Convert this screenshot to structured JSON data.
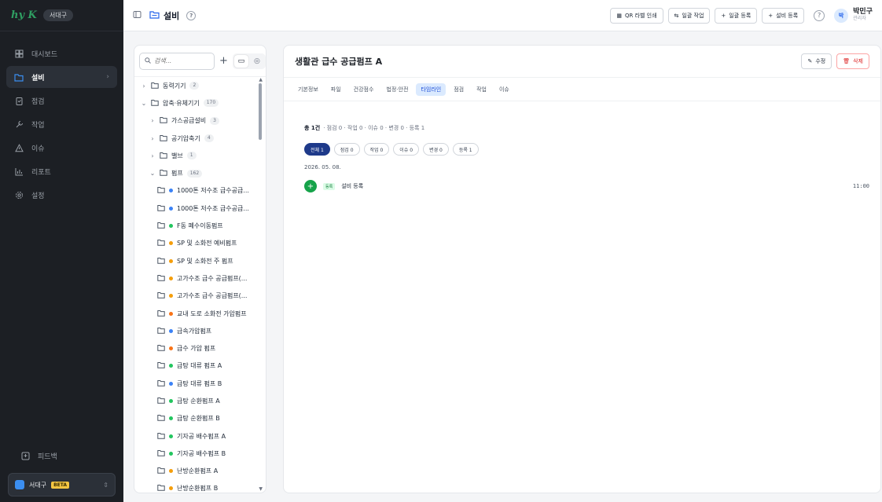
{
  "sidebar": {
    "logo": "hy K",
    "org_chip": "서대구",
    "nav": [
      {
        "label": "대시보드",
        "icon": "dashboard-icon"
      },
      {
        "label": "설비",
        "icon": "folder-icon",
        "active": true
      },
      {
        "label": "점검",
        "icon": "clipboard-icon"
      },
      {
        "label": "작업",
        "icon": "wrench-icon"
      },
      {
        "label": "이슈",
        "icon": "warning-icon"
      },
      {
        "label": "리포트",
        "icon": "chart-icon"
      },
      {
        "label": "설정",
        "icon": "gear-icon"
      }
    ],
    "feedback": "피드백",
    "org_switch": {
      "name": "서대구",
      "badge": "BETA"
    }
  },
  "topbar": {
    "title": "설비",
    "buttons": {
      "qr": "QR 라벨 인쇄",
      "bulk_work": "일괄 작업",
      "bulk_register": "일괄 등록",
      "equipment_register": "설비 등록"
    },
    "user": {
      "initial": "박",
      "name": "박민구",
      "role": "관리자"
    }
  },
  "tree": {
    "search_placeholder": "검색...",
    "items": [
      {
        "type": "group",
        "caret": "›",
        "label": "동력기기",
        "count": "2",
        "indent": 0
      },
      {
        "type": "group",
        "caret": "⌄",
        "label": "압축·유체기기",
        "count": "170",
        "indent": 0,
        "open": true
      },
      {
        "type": "group",
        "caret": "›",
        "label": "가스공급설비",
        "count": "3",
        "indent": 1
      },
      {
        "type": "group",
        "caret": "›",
        "label": "공기압축기",
        "count": "4",
        "indent": 1
      },
      {
        "type": "group",
        "caret": "›",
        "label": "밸브",
        "count": "1",
        "indent": 1
      },
      {
        "type": "group",
        "caret": "⌄",
        "label": "펌프",
        "count": "162",
        "indent": 1,
        "open": true
      },
      {
        "type": "leaf",
        "label": "1000톤 저수조 급수공급...",
        "color": "#3b82f6"
      },
      {
        "type": "leaf",
        "label": "1000톤 저수조 급수공급...",
        "color": "#3b82f6"
      },
      {
        "type": "leaf",
        "label": "F동 폐수이동펌프",
        "color": "#22c55e"
      },
      {
        "type": "leaf",
        "label": "SP 및 소화전 예비펌프",
        "color": "#f59e0b"
      },
      {
        "type": "leaf",
        "label": "SP 및 소화전 주 펌프",
        "color": "#f59e0b"
      },
      {
        "type": "leaf",
        "label": "고가수조 급수 공급펌프(...",
        "color": "#f59e0b"
      },
      {
        "type": "leaf",
        "label": "고가수조 급수 공급펌프(...",
        "color": "#f59e0b"
      },
      {
        "type": "leaf",
        "label": "교내 도로 소화전 가압펌프",
        "color": "#f97316"
      },
      {
        "type": "leaf",
        "label": "급속가압펌프",
        "color": "#3b82f6"
      },
      {
        "type": "leaf",
        "label": "급수 가압 펌프",
        "color": "#f97316"
      },
      {
        "type": "leaf",
        "label": "급탕 대류 펌프 A",
        "color": "#22c55e"
      },
      {
        "type": "leaf",
        "label": "급탕 대류 펌프 B",
        "color": "#3b82f6"
      },
      {
        "type": "leaf",
        "label": "급탕 순환펌프 A",
        "color": "#22c55e"
      },
      {
        "type": "leaf",
        "label": "급탕 순환펌프 B",
        "color": "#22c55e"
      },
      {
        "type": "leaf",
        "label": "기자공 배수펌프 A",
        "color": "#22c55e"
      },
      {
        "type": "leaf",
        "label": "기자공 배수펌프 B",
        "color": "#22c55e"
      },
      {
        "type": "leaf",
        "label": "난방순환펌프 A",
        "color": "#f59e0b"
      },
      {
        "type": "leaf",
        "label": "난방순환펌프 B",
        "color": "#f59e0b"
      }
    ]
  },
  "detail": {
    "title": "생활관 급수 공급펌프 A",
    "edit": "수정",
    "delete": "삭제",
    "tabs": [
      "기본정보",
      "파일",
      "건강점수",
      "법정·안전",
      "타임라인",
      "점검",
      "작업",
      "이슈"
    ],
    "active_tab": "타임라인",
    "summary": {
      "total": "총 1건",
      "rest": "· 점검 0 · 작업 0 · 이슈 0 · 변경 0 · 등록 1"
    },
    "filters": [
      "전체 1",
      "점검 0",
      "작업 0",
      "이슈 0",
      "변경 0",
      "등록 1"
    ],
    "date": "2026. 05. 08.",
    "event": {
      "tag": "등록",
      "text": "설비 등록",
      "time": "11:00"
    }
  }
}
